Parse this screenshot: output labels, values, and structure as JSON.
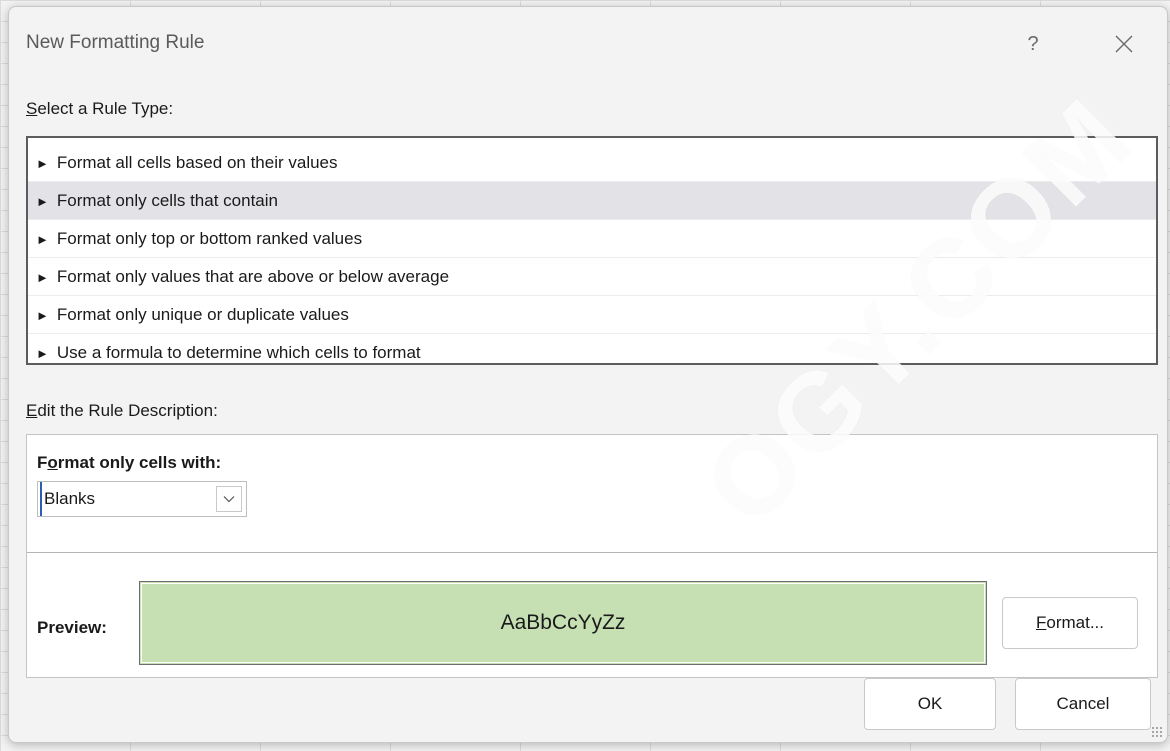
{
  "dialog": {
    "title": "New Formatting Rule",
    "help_label": "?",
    "close_label": "✕"
  },
  "rule_type": {
    "label_mnemonic": "S",
    "label_rest": "elect a Rule Type:",
    "items": [
      {
        "label": "Format all cells based on their values"
      },
      {
        "label": "Format only cells that contain",
        "selected": true
      },
      {
        "label": "Format only top or bottom ranked values"
      },
      {
        "label": "Format only values that are above or below average"
      },
      {
        "label": "Format only unique or duplicate values"
      },
      {
        "label": "Use a formula to determine which cells to format"
      }
    ],
    "arrow_glyph": "►"
  },
  "rule_description": {
    "label_mnemonic": "E",
    "label_rest": "dit the Rule Description:",
    "heading_first": "F",
    "heading_mnemonic": "o",
    "heading_rest": "rmat only cells with:",
    "select_value": "Blanks",
    "select_chevron": "⌄",
    "preview_label": "Preview:",
    "preview_text": "AaBbCcYyZz",
    "preview_fill": "#c6e0b4"
  },
  "buttons": {
    "format_mnemonic": "F",
    "format_rest": "ormat...",
    "ok": "OK",
    "cancel": "Cancel"
  },
  "watermark": "OGY.COM"
}
